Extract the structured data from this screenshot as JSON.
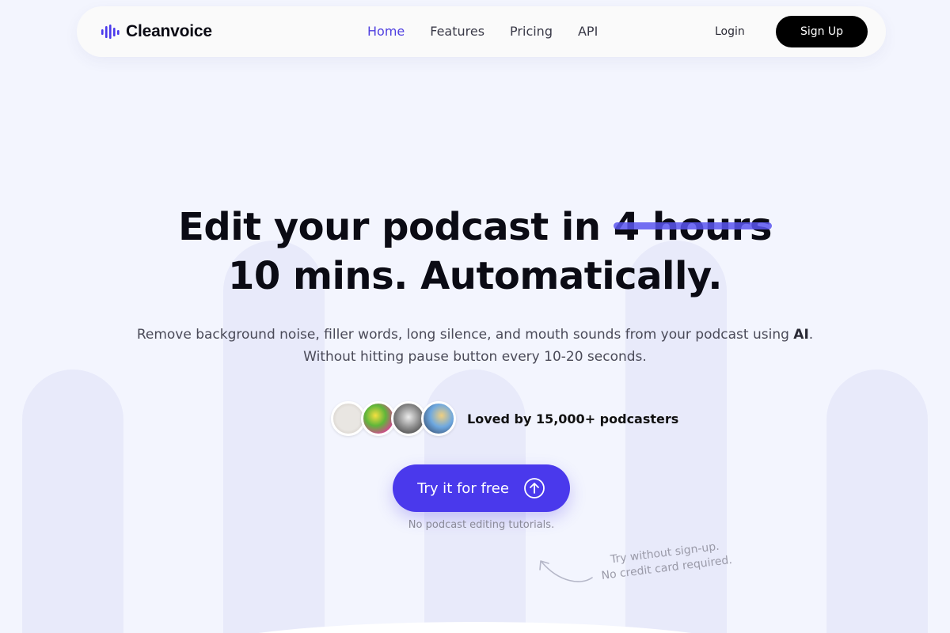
{
  "brand": {
    "name": "Cleanvoice",
    "accent": "#4a39ec",
    "logo_icon": "soundwave-icon"
  },
  "nav": {
    "links": [
      {
        "label": "Home",
        "active": true
      },
      {
        "label": "Features"
      },
      {
        "label": "Pricing"
      },
      {
        "label": "API"
      }
    ],
    "login": "Login",
    "signup": "Sign Up"
  },
  "hero": {
    "headline_prefix": "Edit your podcast in ",
    "headline_struck": "4 hours",
    "headline_line2": "10 mins. Automatically.",
    "subtitle_line1": "Remove background noise, filler words, long silence, and mouth sounds from your podcast using ",
    "subtitle_emphasis": "AI",
    "subtitle_end": ".",
    "subtitle_line2": "Without hitting pause button every 10-20 seconds."
  },
  "social_proof": {
    "text": "Loved by 15,000+ podcasters",
    "avatars": [
      "avatar-1",
      "avatar-2",
      "avatar-3",
      "avatar-4"
    ]
  },
  "cta": {
    "label": "Try it for free",
    "icon": "arrow-up-circle-icon",
    "note": "No podcast editing tutorials.",
    "handwritten_line1": "Try without sign-up.",
    "handwritten_line2": "No credit card required."
  }
}
